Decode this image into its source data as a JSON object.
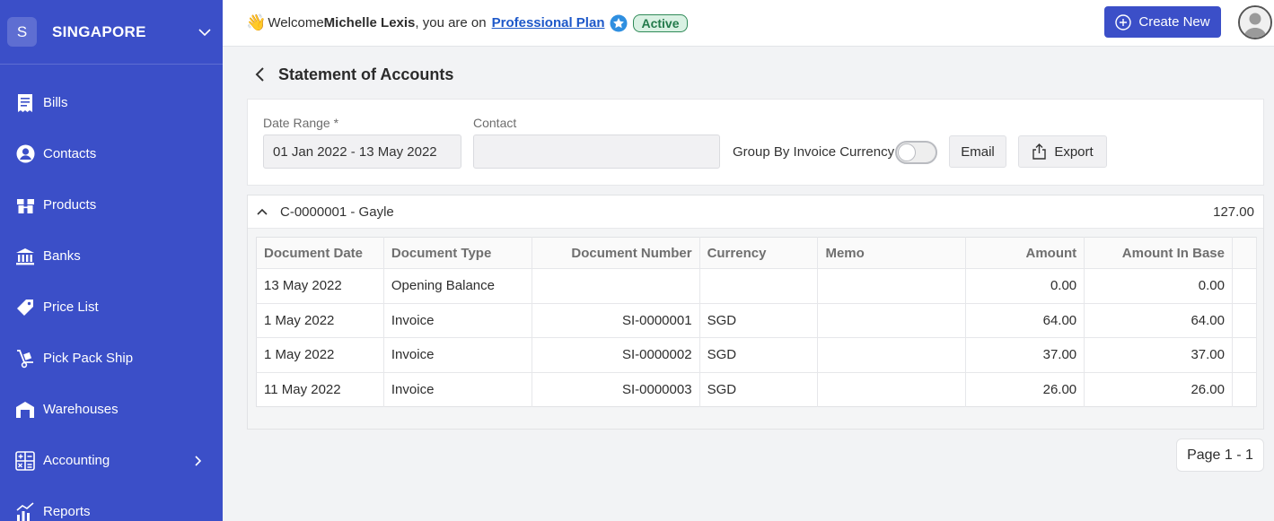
{
  "org": {
    "initial": "S",
    "name": "SINGAPORE"
  },
  "sidebar": {
    "items": [
      {
        "label": "Bills",
        "icon": "bills-icon"
      },
      {
        "label": "Contacts",
        "icon": "contacts-icon"
      },
      {
        "label": "Products",
        "icon": "products-icon"
      },
      {
        "label": "Banks",
        "icon": "bank-icon"
      },
      {
        "label": "Price List",
        "icon": "price-tag-icon"
      },
      {
        "label": "Pick Pack Ship",
        "icon": "hand-truck-icon"
      },
      {
        "label": "Warehouses",
        "icon": "warehouse-icon"
      },
      {
        "label": "Accounting",
        "icon": "calculator-icon"
      },
      {
        "label": "Reports",
        "icon": "reports-icon"
      }
    ]
  },
  "topbar": {
    "welcome_prefix": "Welcome ",
    "user_name": "Michelle Lexis",
    "welcome_suffix": ", you are on",
    "plan": "Professional Plan",
    "status": "Active",
    "create_label": "Create New"
  },
  "page": {
    "title": "Statement of Accounts"
  },
  "filters": {
    "date_range_label": "Date Range *",
    "date_range_value": "01 Jan 2022 - 13 May 2022",
    "contact_label": "Contact",
    "contact_value": "",
    "group_by_label": "Group By Invoice Currency",
    "group_by_on": false,
    "email_label": "Email",
    "export_label": "Export"
  },
  "contact_group": {
    "title": "C-0000001 - Gayle",
    "total": "127.00"
  },
  "table": {
    "headers": [
      "Document Date",
      "Document Type",
      "Document Number",
      "Currency",
      "Memo",
      "Amount",
      "Amount In Base"
    ],
    "rows": [
      [
        "13 May 2022",
        "Opening Balance",
        "",
        "",
        "",
        "0.00",
        "0.00"
      ],
      [
        "1 May 2022",
        "Invoice",
        "SI-0000001",
        "SGD",
        "",
        "64.00",
        "64.00"
      ],
      [
        "1 May 2022",
        "Invoice",
        "SI-0000002",
        "SGD",
        "",
        "37.00",
        "37.00"
      ],
      [
        "11 May 2022",
        "Invoice",
        "SI-0000003",
        "SGD",
        "",
        "26.00",
        "26.00"
      ]
    ]
  },
  "pager": {
    "label": "Page 1 - 1"
  },
  "colors": {
    "brand": "#3b4fc8",
    "active_badge": "#d9f1e3",
    "link": "#1d58c9"
  }
}
